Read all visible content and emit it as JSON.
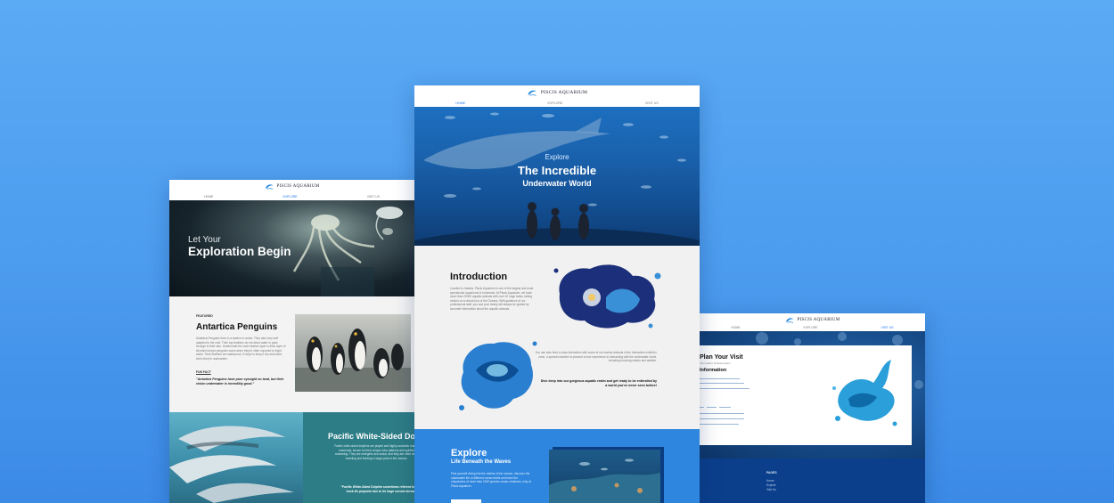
{
  "brand": {
    "name": "PISCIS AQUARIUM"
  },
  "nav": {
    "home": "HOME",
    "explore": "EXPLORE",
    "visit": "VISIT US"
  },
  "left": {
    "hero_sub": "Let Your",
    "hero_title": "Exploration Begin",
    "featured_label": "FEATURED",
    "penguin_title": "Antartica Penguins",
    "penguin_text": "Antartica Penguins lives in a waters in ocean. They also very well adapted to the cold. Their top feathers do not allow water to pass through to their skin. Underneath the outer feather layer is thick layer of fat which keeps penguins warm when they're often exposed to frigid water. Their feathers are waterproof, it helps to keep it dry and warm when they're underwater.",
    "funfact_label": "FUN FACT",
    "funfact_quote": "\"Antartica Penguins have poor eyesight on land, but their vision underwater is incredibly good.\"",
    "dolphin_title": "Pacific White-Sided Dolphin",
    "dolphin_text": "Pacific white-sided dolphins are playful and highly acrobatic marine mammals, known for their unique color patterns and spirited swimming. They are energetic and social, and they are often seen traveling and feeding in large pods in the oceans.",
    "dolphin_quote": "\"Pacific White-Sided Dolphin sometimes referred to as a hook-fin porpoise due to its large curved dorsal fin.\""
  },
  "center": {
    "hero_explore": "Explore",
    "hero_line1": "The Incredible",
    "hero_line2": "Underwater World",
    "intro_title": "Introduction",
    "intro_text": "Located in Jakarta, Piscis Aquarium is one of the largest and most spectacular aquariums in Indonesia. At Piscis Aquarium, we have more than 20000 aquatic animals with over 10 huge tanks, taking visitors on a virtual tour of the Oceans. With guidance of our professional staff, you and your family will always be guided by accurate information about the aquatic animals.",
    "intro_text2": "You can also feed a close interaction with some of our marine animals in the Interactive exhibit in zone, a special chamber to present a new experience to interacting with the underwater world, including touching sharks and starfish.",
    "intro_dive": "Dive deep into our gorgeous aquatic realm and get ready to be enthralled by a world you've never seen before!",
    "explore_title": "Explore",
    "explore_sub": "Life Beneath the Waves",
    "explore_text": "Find yourself diving into the realms of the oceans, discover the underwater life of different ocean levels and learn the uniqueness of more than 1000 species ocean creatures, only at Piscis Aquarium."
  },
  "right": {
    "visit_title": "Plan Your Visit",
    "visit_sub": "Information & Reservation",
    "info_title": "Information",
    "footer_pages_label": "PAGES",
    "footer_links": [
      "Home",
      "Explore",
      "Visit Us"
    ]
  }
}
